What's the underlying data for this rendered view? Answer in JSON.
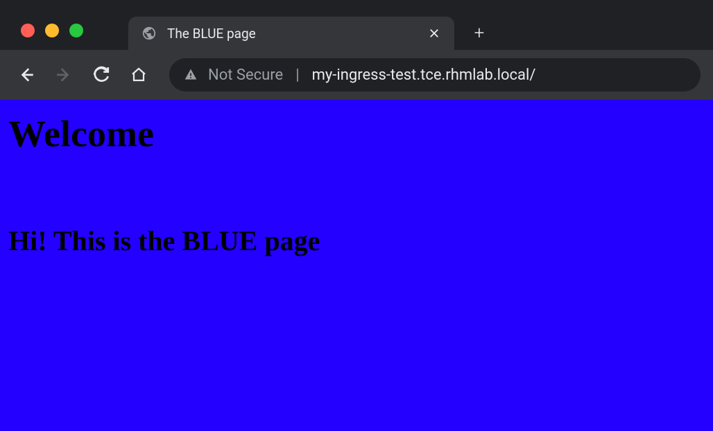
{
  "browser": {
    "tab": {
      "title": "The BLUE page"
    },
    "address_bar": {
      "security_label": "Not Secure",
      "url": "my-ingress-test.tce.rhmlab.local/"
    }
  },
  "page": {
    "heading": "Welcome",
    "subheading": "Hi! This is the BLUE page",
    "background_color": "#2300ff"
  }
}
